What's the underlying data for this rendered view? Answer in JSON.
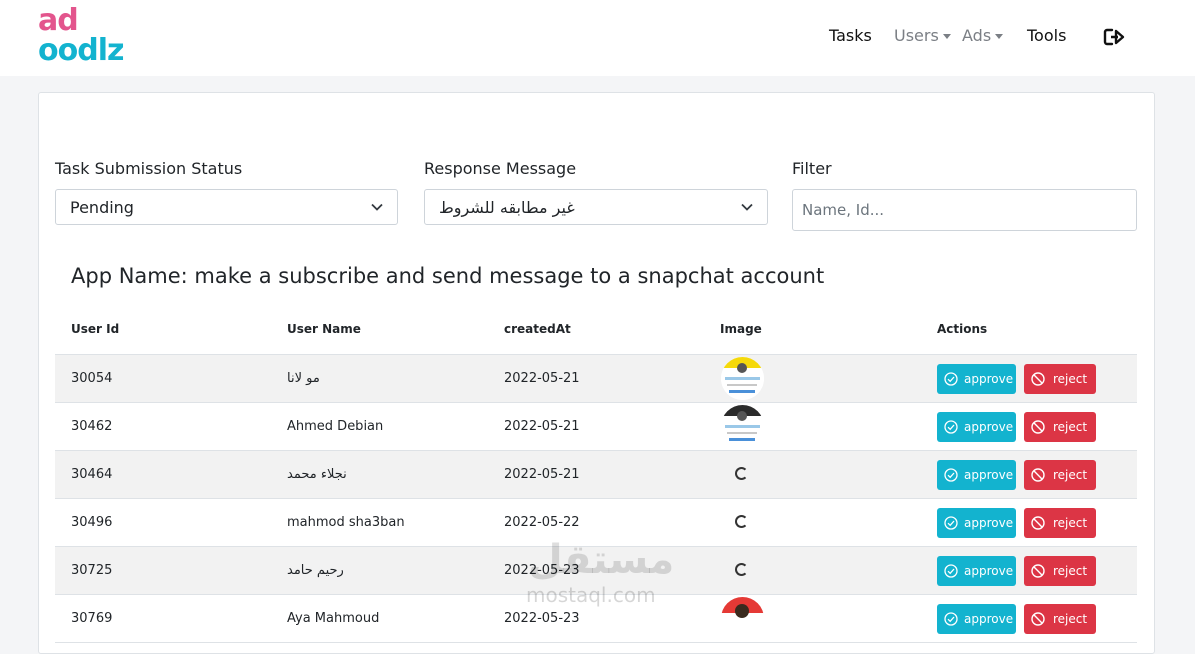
{
  "brand": {
    "logo_line1": "ad",
    "logo_line2": "oodlz",
    "colors": {
      "pink": "#e3558d",
      "cyan": "#13b3cf"
    }
  },
  "nav": {
    "tasks": "Tasks",
    "users": "Users",
    "ads": "Ads",
    "tools": "Tools",
    "logout_icon": "logout-icon"
  },
  "filters": {
    "status_label": "Task Submission Status",
    "status_value": "Pending",
    "response_label": "Response Message",
    "response_value": "غير مطابقه للشروط",
    "filter_label": "Filter",
    "filter_placeholder": "Name, Id..."
  },
  "app_title": "App Name: make a subscribe and send message to a snapchat account",
  "table": {
    "headers": [
      "User Id",
      "User Name",
      "createdAt",
      "Image",
      "Actions"
    ],
    "approve_label": "approve",
    "reject_label": "reject",
    "rows": [
      {
        "user_id": "30054",
        "user_name": "مو لانا",
        "created_at": "2022-05-21",
        "image": "thumbnail"
      },
      {
        "user_id": "30462",
        "user_name": "Ahmed Debian",
        "created_at": "2022-05-21",
        "image": "thumbnail"
      },
      {
        "user_id": "30464",
        "user_name": "نجلاء محمد",
        "created_at": "2022-05-21",
        "image": "loading"
      },
      {
        "user_id": "30496",
        "user_name": "mahmod sha3ban",
        "created_at": "2022-05-22",
        "image": "loading"
      },
      {
        "user_id": "30725",
        "user_name": "رحيم حامد",
        "created_at": "2022-05-23",
        "image": "loading"
      },
      {
        "user_id": "30769",
        "user_name": "Aya Mahmoud",
        "created_at": "2022-05-23",
        "image": "thumbnail"
      }
    ]
  },
  "watermark": {
    "arabic": "مستقل",
    "latin": "mostaql.com"
  }
}
